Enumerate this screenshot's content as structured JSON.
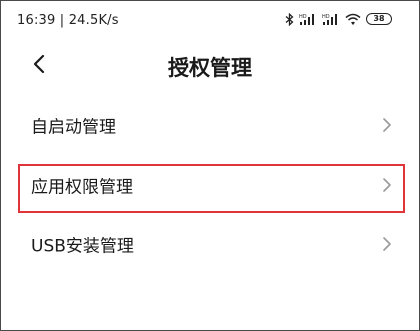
{
  "status_bar": {
    "time_speed": "16:39 | 24.5K/s",
    "icons": [
      "bluetooth-icon",
      "signal-hd-icon",
      "signal-hd-icon",
      "wifi-icon",
      "battery-icon"
    ],
    "battery_level": "38"
  },
  "header": {
    "back_icon": "chevron-left-icon",
    "title": "授权管理"
  },
  "list": {
    "items": [
      {
        "label": "自启动管理",
        "icon": "chevron-right-icon"
      },
      {
        "label": "应用权限管理",
        "icon": "chevron-right-icon",
        "highlighted": true
      },
      {
        "label": "USB安装管理",
        "icon": "chevron-right-icon"
      }
    ]
  },
  "colors": {
    "highlight_border": "#e0343a",
    "text": "#1a1a1a",
    "chevron": "#9a9a9a",
    "background": "#ffffff"
  }
}
